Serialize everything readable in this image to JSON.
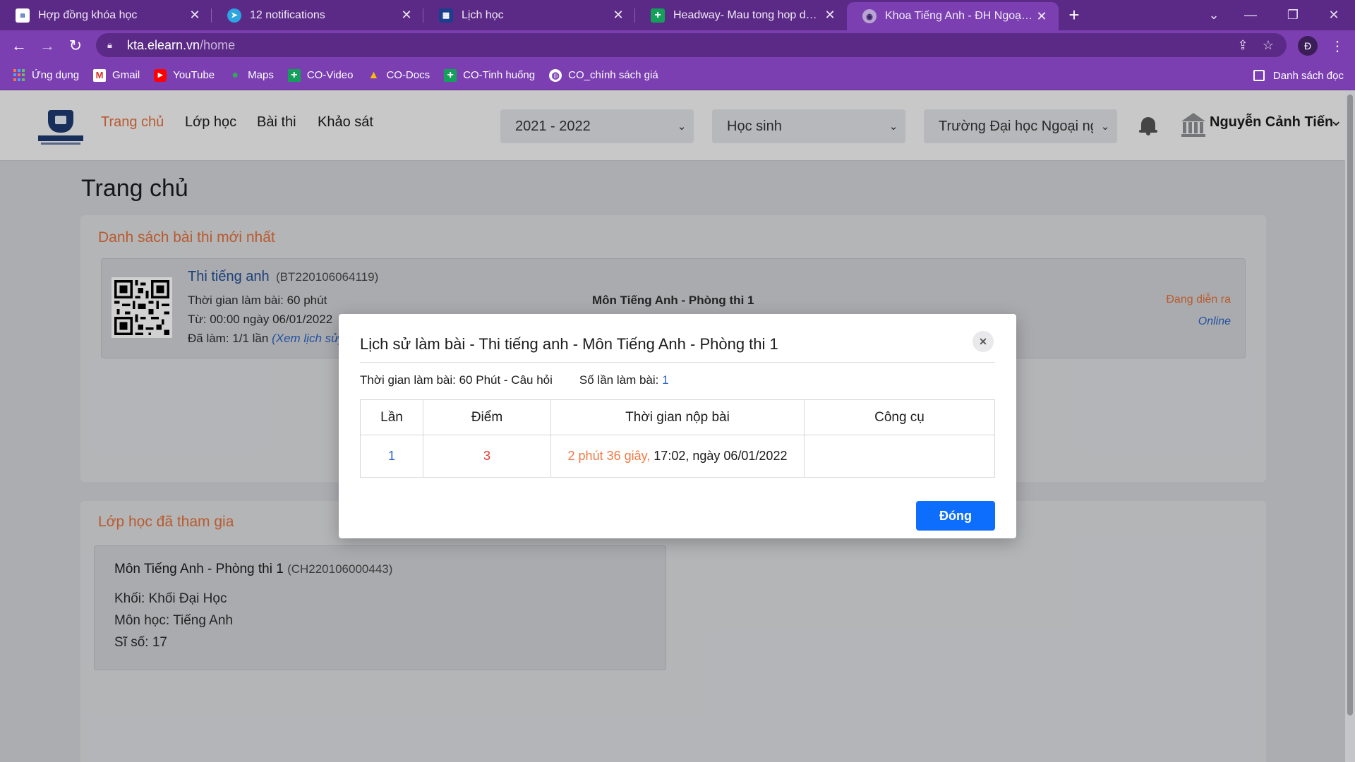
{
  "browser": {
    "tabs": [
      {
        "title": "Hợp đồng khóa học",
        "favicon": "doc-icon"
      },
      {
        "title": "12 notifications",
        "favicon": "telegram-icon"
      },
      {
        "title": "Lịch học",
        "favicon": "calendar-icon"
      },
      {
        "title": "Headway- Mau tong hop du lieu",
        "favicon": "sheets-icon"
      },
      {
        "title": "Khoa Tiếng Anh - ĐH Ngoại Ngữ",
        "favicon": "globe-icon",
        "active": true
      }
    ],
    "url_host": "kta.elearn.vn",
    "url_path": "/home",
    "profile_initial": "Đ",
    "bookmarks": [
      {
        "label": "Ứng dụng",
        "icon": "apps-grid-icon"
      },
      {
        "label": "Gmail",
        "icon": "gmail-icon"
      },
      {
        "label": "YouTube",
        "icon": "youtube-icon"
      },
      {
        "label": "Maps",
        "icon": "maps-icon"
      },
      {
        "label": "CO-Video",
        "icon": "sheets-icon"
      },
      {
        "label": "CO-Docs",
        "icon": "drive-icon"
      },
      {
        "label": "CO-Tinh huống",
        "icon": "sheets-icon"
      },
      {
        "label": "CO_chính sách giá",
        "icon": "globe-icon"
      }
    ],
    "reading_list": "Danh sách đọc"
  },
  "nav": {
    "menu": [
      "Trang chủ",
      "Lớp học",
      "Bài thi",
      "Khảo sát"
    ],
    "year_select": "2021 - 2022",
    "role_select": "Học sinh",
    "school_select": "Trường Đại học Ngoại ngữ",
    "username": "Nguyễn Cảnh Tiến"
  },
  "main": {
    "page_title": "Trang chủ",
    "exams_heading": "Danh sách bài thi mới nhất",
    "exam": {
      "name": "Thi tiếng anh",
      "code": "(BT220106064119)",
      "duration": "Thời gian làm bài: 60 phút",
      "from": "Từ: 00:00   ngày 06/01/2022",
      "done_prefix": "Đã làm: 1/1 lần ",
      "done_link": "(Xem lịch sử)",
      "room": "Môn Tiếng Anh - Phòng thi 1",
      "status": "Đang diễn ra",
      "mode": "Online"
    },
    "classes_heading": "Lớp học đã tham gia",
    "class": {
      "name": "Môn Tiếng Anh - Phòng thi 1",
      "code": "(CH220106000443)",
      "grade": "Khối: Khối Đại Học",
      "subject": "Môn học: Tiếng Anh",
      "size": "Sĩ số: 17"
    }
  },
  "modal": {
    "title": "Lịch sử làm bài - Thi tiếng anh - Môn Tiếng Anh - Phòng thi 1",
    "meta_duration": "Thời gian làm bài: 60 Phút - Câu hỏi",
    "meta_attempts_label": "Số lần làm bài:",
    "meta_attempts_value": "1",
    "columns": [
      "Lần",
      "Điểm",
      "Thời gian nộp bài",
      "Công cụ"
    ],
    "rows": [
      {
        "attempt": "1",
        "score": "3",
        "duration": "2 phút 36 giây,",
        "submitted": " 17:02, ngày 06/01/2022",
        "tools": ""
      }
    ],
    "close_label": "Đóng"
  }
}
